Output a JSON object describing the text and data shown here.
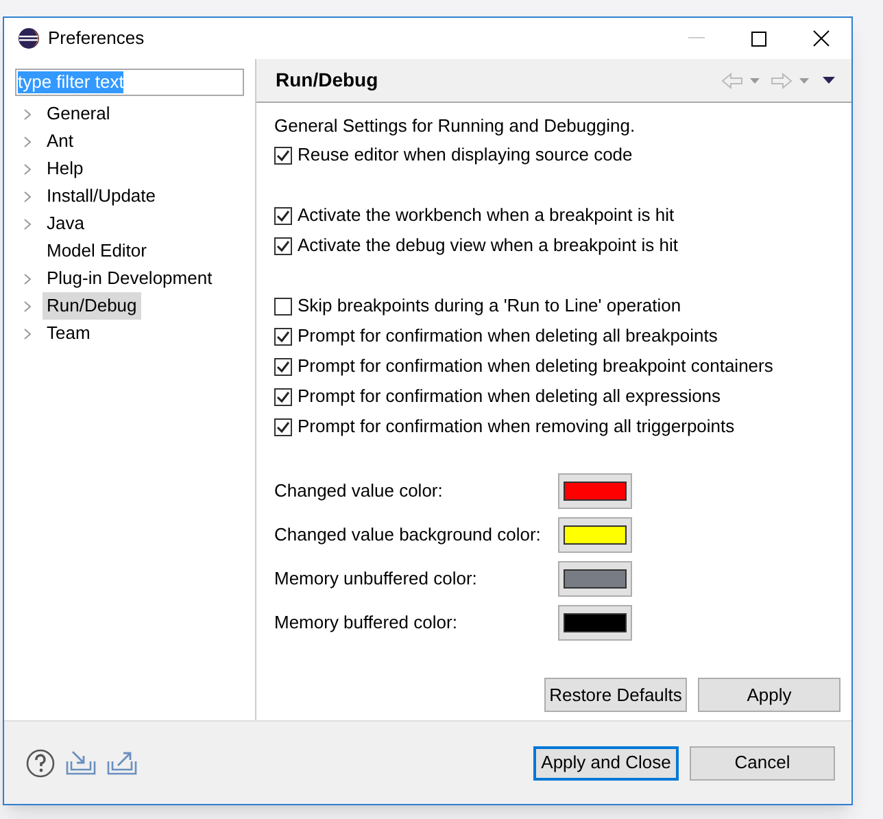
{
  "window": {
    "title": "Preferences"
  },
  "filter": {
    "value": "type filter text"
  },
  "tree": [
    {
      "label": "General",
      "expandable": true,
      "selected": false
    },
    {
      "label": "Ant",
      "expandable": true,
      "selected": false
    },
    {
      "label": "Help",
      "expandable": true,
      "selected": false
    },
    {
      "label": "Install/Update",
      "expandable": true,
      "selected": false
    },
    {
      "label": "Java",
      "expandable": true,
      "selected": false
    },
    {
      "label": "Model Editor",
      "expandable": false,
      "selected": false
    },
    {
      "label": "Plug-in Development",
      "expandable": true,
      "selected": false
    },
    {
      "label": "Run/Debug",
      "expandable": true,
      "selected": true
    },
    {
      "label": "Team",
      "expandable": true,
      "selected": false
    }
  ],
  "page": {
    "title": "Run/Debug",
    "description": "General Settings for Running and Debugging.",
    "groups": [
      [
        {
          "label": "Reuse editor when displaying source code",
          "checked": true
        }
      ],
      [
        {
          "label": "Activate the workbench when a breakpoint is hit",
          "checked": true
        },
        {
          "label": "Activate the debug view when a breakpoint is hit",
          "checked": true
        }
      ],
      [
        {
          "label": "Skip breakpoints during a 'Run to Line' operation",
          "checked": false
        },
        {
          "label": "Prompt for confirmation when deleting all breakpoints",
          "checked": true
        },
        {
          "label": "Prompt for confirmation when deleting breakpoint containers",
          "checked": true
        },
        {
          "label": "Prompt for confirmation when deleting all expressions",
          "checked": true
        },
        {
          "label": "Prompt for confirmation when removing all triggerpoints",
          "checked": true
        }
      ]
    ],
    "colors": [
      {
        "label": "Changed value color:",
        "color": "#ff0000"
      },
      {
        "label": "Changed value background color:",
        "color": "#ffff00"
      },
      {
        "label": "Memory unbuffered color:",
        "color": "#787c84"
      },
      {
        "label": "Memory buffered color:",
        "color": "#000000"
      }
    ],
    "buttons": [
      "Restore Defaults",
      "Apply"
    ]
  },
  "footer_buttons": [
    {
      "label": "Apply and Close",
      "default": true
    },
    {
      "label": "Cancel",
      "default": false
    }
  ]
}
